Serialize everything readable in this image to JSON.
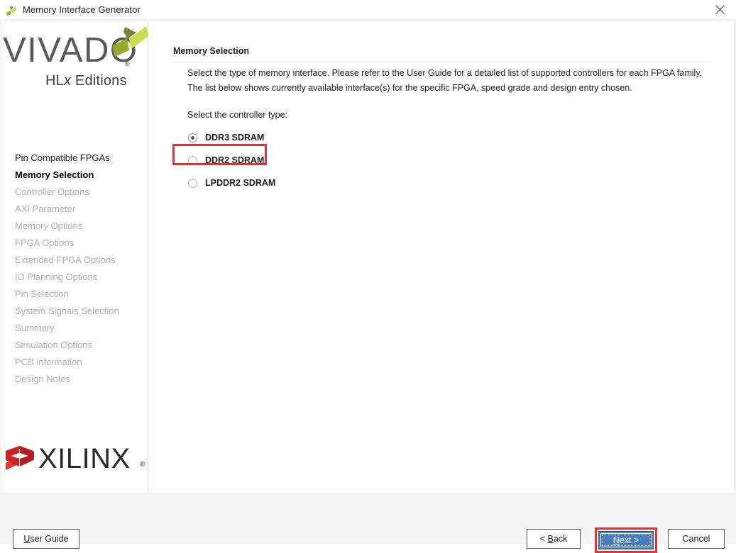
{
  "window": {
    "title": "Memory Interface Generator",
    "app_icon": "vivado-pinwheel-icon",
    "close_icon": "close-icon"
  },
  "sidebar": {
    "logo": {
      "wordmark": "VIVADO",
      "registered": "®",
      "subtitle_prefix": "HL",
      "subtitle_italic": "x",
      "subtitle_suffix": " Editions"
    },
    "items": [
      {
        "label": "Pin Compatible FPGAs",
        "state": "done"
      },
      {
        "label": "Memory Selection",
        "state": "active"
      },
      {
        "label": "Controller Options",
        "state": "disabled"
      },
      {
        "label": "AXI Parameter",
        "state": "disabled"
      },
      {
        "label": "Memory Options",
        "state": "disabled"
      },
      {
        "label": "FPGA Options",
        "state": "disabled"
      },
      {
        "label": "Extended FPGA Options",
        "state": "disabled"
      },
      {
        "label": "IO Planning Options",
        "state": "disabled"
      },
      {
        "label": "Pin Selection",
        "state": "disabled"
      },
      {
        "label": "System Signals Selection",
        "state": "disabled"
      },
      {
        "label": "Summary",
        "state": "disabled"
      },
      {
        "label": "Simulation Options",
        "state": "disabled"
      },
      {
        "label": "PCB information",
        "state": "disabled"
      },
      {
        "label": "Design Notes",
        "state": "disabled"
      }
    ],
    "vendor_logo": {
      "wordmark": "XILINX",
      "registered": "®"
    }
  },
  "main": {
    "header": "Memory Selection",
    "description_line1": "Select the type of memory interface. Please refer to the User Guide for a detailed list of supported controllers for each FPGA family.",
    "description_line2": "The list below shows currently available interface(s) for the specific FPGA, speed grade and design entry chosen.",
    "select_label": "Select the controller type:",
    "controller_options": [
      {
        "label": "DDR3 SDRAM",
        "selected": true
      },
      {
        "label": "DDR2 SDRAM",
        "selected": false
      },
      {
        "label": "LPDDR2 SDRAM",
        "selected": false
      }
    ]
  },
  "footer": {
    "user_guide": {
      "mnemonic": "U",
      "rest": "ser Guide"
    },
    "back": {
      "prefix": "< ",
      "mnemonic": "B",
      "rest": "ack"
    },
    "next": {
      "mnemonic": "N",
      "rest": "ext >"
    },
    "cancel": "Cancel"
  },
  "annotations": {
    "highlight_color": "#e33434",
    "targets": [
      "ddr3-sdram-radio",
      "next-button"
    ]
  }
}
